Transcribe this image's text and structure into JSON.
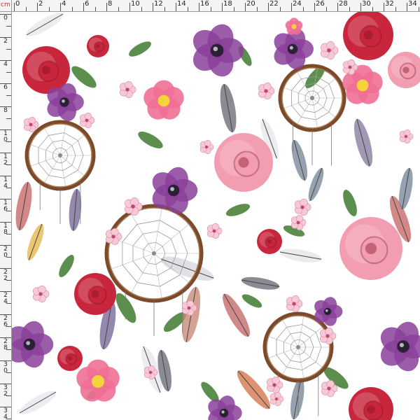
{
  "ruler": {
    "unit_label": "cm",
    "x_ticks": [
      "0",
      "2",
      "4",
      "6",
      "8",
      "10",
      "12",
      "14",
      "16",
      "18",
      "20",
      "22",
      "24",
      "26",
      "28",
      "30",
      "32",
      "34"
    ],
    "y_ticks": [
      "0",
      "2",
      "4",
      "6",
      "8",
      "10",
      "12",
      "14",
      "16",
      "18",
      "20",
      "22",
      "24",
      "26",
      "28",
      "30",
      "32",
      "34"
    ],
    "color_unit": "#c0392b"
  },
  "pattern": {
    "description_icons": [
      "dreamcatcher-icon",
      "rose-icon",
      "poppy-icon",
      "wild-rose-icon",
      "feather-icon",
      "leaf-icon",
      "blossom-icon"
    ],
    "colors": {
      "rose_red": "#c8263d",
      "rose_pink": "#f29db0",
      "poppy_purple": "#8a3f9a",
      "wild_rose": "#ef6f95",
      "leaf": "#3f7a2e",
      "feather_grey": "#6d6e78",
      "hoop": "#7a4a2b",
      "blossom": "#f7c8d6"
    }
  }
}
